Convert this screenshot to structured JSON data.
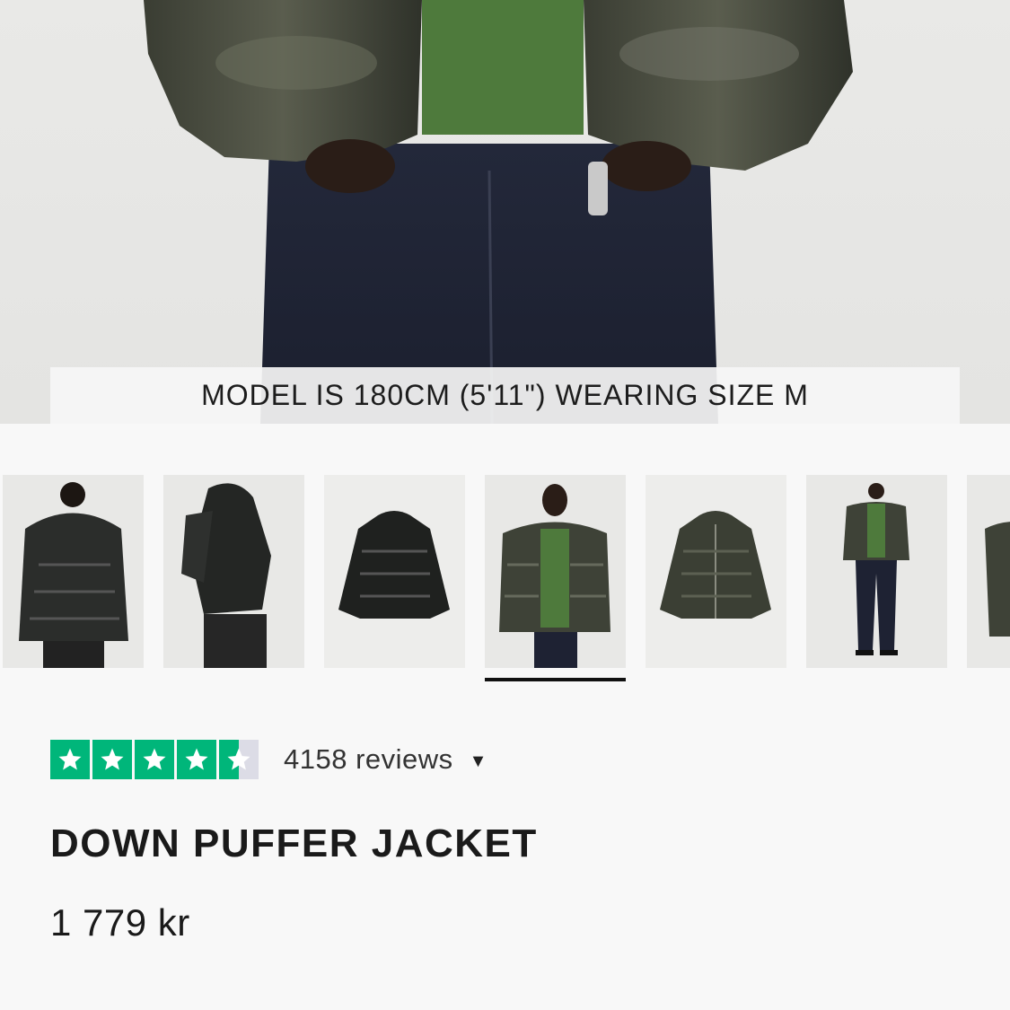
{
  "hero": {
    "caption": "MODEL IS 180CM (5'11\") WEARING SIZE M"
  },
  "thumbnails": [
    {
      "view": "back-hooded",
      "selected": false
    },
    {
      "view": "side-hooded",
      "selected": false
    },
    {
      "view": "flat-back",
      "selected": false
    },
    {
      "view": "front-model",
      "selected": true
    },
    {
      "view": "flat-front",
      "selected": false
    },
    {
      "view": "full-body",
      "selected": false
    },
    {
      "view": "detail",
      "selected": false
    }
  ],
  "rating": {
    "stars": 4.5,
    "reviews_label": "4158 reviews",
    "caret": "▼",
    "star_color": "#00b67a",
    "empty_color": "#dcdce6"
  },
  "product": {
    "title": "DOWN PUFFER JACKET",
    "price": "1 779 kr"
  }
}
